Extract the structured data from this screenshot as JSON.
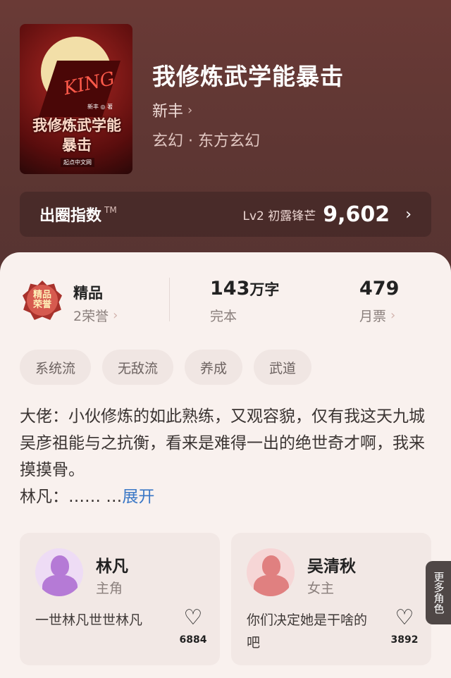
{
  "book": {
    "title": "我修炼武学能暴击",
    "author": "新丰",
    "genre": "玄幻 · 东方玄幻",
    "cover": {
      "king_text": "KING",
      "title_text": "我修炼武学能暴击",
      "author_text": "新丰 ◎ 著",
      "publisher_text": "起点中文网"
    }
  },
  "circle_index": {
    "label": "出圈指数",
    "tm": "TM",
    "level": "Lv2 初露锋芒",
    "score": "9,602"
  },
  "stats": {
    "honor": {
      "badge_text": "精品\n荣誉",
      "title": "精品",
      "sub": "2荣誉"
    },
    "words": {
      "value": "143",
      "unit": "万字",
      "sub": "完本"
    },
    "tickets": {
      "value": "479",
      "sub": "月票"
    }
  },
  "tags": [
    "系统流",
    "无敌流",
    "养成",
    "武道"
  ],
  "description": {
    "text": "大佬：小伙修炼的如此熟练，又观容貌，仅有我这天九城吴彦祖能与之抗衡，看来是难得一出的绝世奇才啊，我来摸摸骨。",
    "line2": "林凡：…… …",
    "expand_label": "展开"
  },
  "characters": [
    {
      "name": "林凡",
      "role": "主角",
      "quote": "一世林凡世世林凡",
      "likes": "6884",
      "avatar_color": "#b57ad6"
    },
    {
      "name": "吴清秋",
      "role": "女主",
      "quote": "你们决定她是干啥的吧",
      "likes": "3892",
      "avatar_color": "#e08080"
    }
  ],
  "more_roles_label": "更多角色",
  "colors": {
    "accent_link": "#3b78c6",
    "header_bg": "#5a3532",
    "sheet_bg": "#f9f1ee"
  }
}
